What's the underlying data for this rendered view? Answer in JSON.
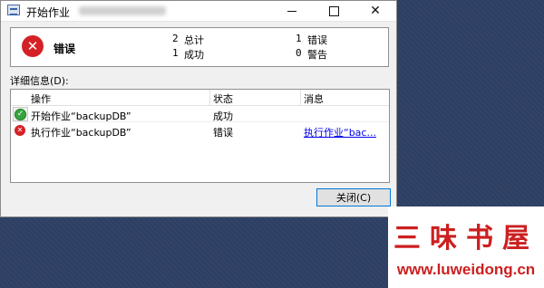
{
  "window": {
    "title": "开始作业",
    "close_glyph": "✕"
  },
  "summary": {
    "status": "错误",
    "total_count": "2",
    "total_label": "总计",
    "success_count": "1",
    "success_label": "成功",
    "error_count": "1",
    "error_label": "错误",
    "warning_count": "0",
    "warning_label": "警告"
  },
  "details_label": "详细信息(D):",
  "grid": {
    "columns": [
      "操作",
      "状态",
      "消息"
    ],
    "rows": [
      {
        "icon": "success-icon",
        "action": "开始作业“backupDB”",
        "status": "成功",
        "message": ""
      },
      {
        "icon": "error-icon",
        "action": "执行作业“backupDB”",
        "status": "错误",
        "message": "执行作业“bac..."
      }
    ]
  },
  "buttons": {
    "close": "关闭(C)"
  },
  "watermark": {
    "logo_text": "三味书屋",
    "url": "www.luweidong.cn"
  },
  "colors": {
    "error_red": "#d42127",
    "success_green": "#37a440",
    "link_blue": "#0000ee",
    "desktop": "#2d3f63"
  }
}
